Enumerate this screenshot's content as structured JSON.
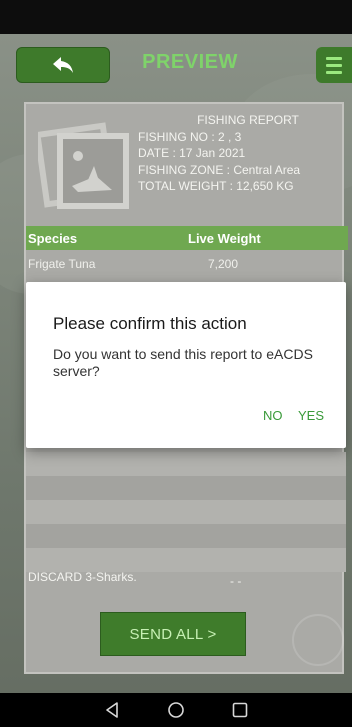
{
  "header": {
    "title": "PREVIEW"
  },
  "report": {
    "heading": "FISHING REPORT",
    "fishing_no": "FISHING NO : 2 , 3",
    "date": "DATE : 17 Jan 2021",
    "zone": "FISHING ZONE : Central Area",
    "total_weight": "TOTAL WEIGHT : 12,650 KG"
  },
  "table": {
    "headers": [
      "Species",
      "Live Weight"
    ],
    "rows": [
      {
        "species": "Frigate Tuna",
        "weight": "7,200"
      }
    ]
  },
  "discard": {
    "label": "DISCARD 3-Sharks.",
    "value": "- -"
  },
  "actions": {
    "send_all": "SEND ALL >"
  },
  "dialog": {
    "title": "Please confirm this action",
    "message": "Do you want to send this report to eACDS server?",
    "no": "NO",
    "yes": "YES"
  },
  "colors": {
    "accent": "#3e7a2b",
    "title": "#7fd36a",
    "table_header": "#6fa850",
    "dialog_buttons": "#3a9a3a"
  },
  "icons": [
    "back-arrow-icon",
    "menu-icon",
    "report-logo-icon",
    "nav-back-icon",
    "nav-home-icon",
    "nav-recents-icon"
  ]
}
